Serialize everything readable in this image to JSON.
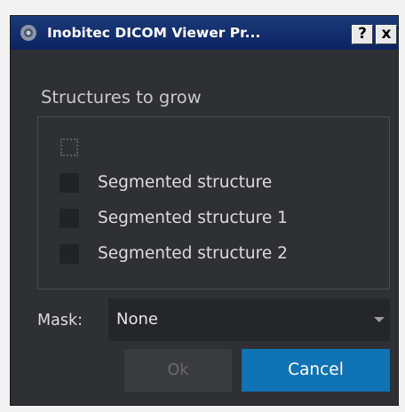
{
  "window": {
    "title": "Inobitec DICOM Viewer Pr...",
    "icon": "inobitec-logo-icon",
    "help_label": "?",
    "close_label": "x"
  },
  "structures": {
    "title": "Structures to grow",
    "items": [
      {
        "label": "Segmented structure",
        "checked": false
      },
      {
        "label": "Segmented structure 1",
        "checked": false
      },
      {
        "label": "Segmented structure 2",
        "checked": false
      }
    ]
  },
  "mask": {
    "label": "Mask:",
    "value": "None"
  },
  "buttons": {
    "ok": "Ok",
    "cancel": "Cancel"
  },
  "colors": {
    "titlebar": "#0b2461",
    "background": "#2f3033",
    "accent": "#0f73b4",
    "text": "#dcdcdc"
  }
}
